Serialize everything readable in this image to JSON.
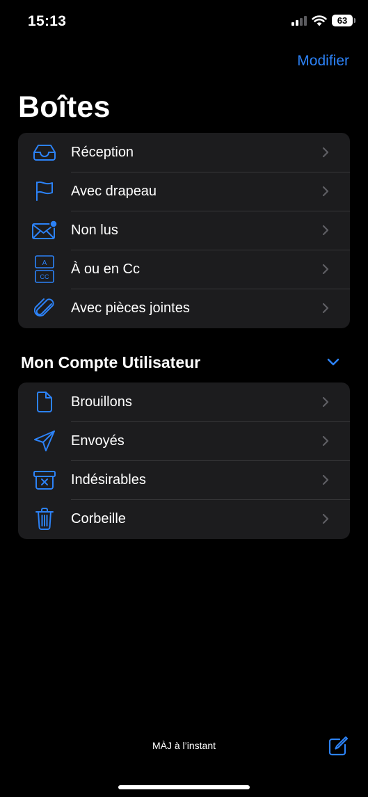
{
  "status_bar": {
    "time": "15:13",
    "battery": "63",
    "signal_icon": "cellular-signal-icon",
    "wifi_icon": "wifi-icon"
  },
  "nav": {
    "edit_label": "Modifier"
  },
  "title": "Boîtes",
  "mailboxes": [
    {
      "label": "Réception",
      "icon": "inbox-tray-icon"
    },
    {
      "label": "Avec drapeau",
      "icon": "flag-icon"
    },
    {
      "label": "Non lus",
      "icon": "unread-envelope-icon"
    },
    {
      "label": "À ou en Cc",
      "icon": "to-cc-icon",
      "icon_text_top": "A",
      "icon_text_bottom": "CC"
    },
    {
      "label": "Avec pièces jointes",
      "icon": "paperclip-icon"
    }
  ],
  "account": {
    "title": "Mon Compte Utilisateur",
    "expanded": true,
    "folders": [
      {
        "label": "Brouillons",
        "icon": "document-icon"
      },
      {
        "label": "Envoyés",
        "icon": "paper-plane-icon"
      },
      {
        "label": "Indésirables",
        "icon": "junk-box-icon"
      },
      {
        "label": "Corbeille",
        "icon": "trash-icon"
      }
    ]
  },
  "toolbar": {
    "update_status": "MÀJ à l’instant",
    "compose_icon": "compose-icon"
  },
  "colors": {
    "accent": "#2c82f7",
    "background": "#000000",
    "card": "#1c1c1e",
    "separator": "#38383a",
    "chevron": "#5e5e63"
  }
}
